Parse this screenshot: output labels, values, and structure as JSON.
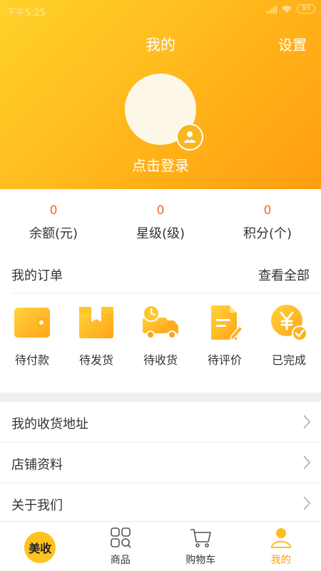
{
  "status_bar": {
    "time": "下午5:25",
    "battery": "93"
  },
  "header": {
    "title": "我的",
    "settings_label": "设置",
    "login_prompt": "点击登录"
  },
  "stats": [
    {
      "value": "0",
      "label": "余额(元)"
    },
    {
      "value": "0",
      "label": "星级(级)"
    },
    {
      "value": "0",
      "label": "积分(个)"
    }
  ],
  "orders": {
    "title": "我的订单",
    "view_all": "查看全部",
    "items": [
      {
        "label": "待付款",
        "icon": "wallet-icon"
      },
      {
        "label": "待发货",
        "icon": "package-box-icon"
      },
      {
        "label": "待收货",
        "icon": "delivery-truck-icon"
      },
      {
        "label": "待评价",
        "icon": "document-edit-icon"
      },
      {
        "label": "已完成",
        "icon": "yen-check-icon"
      }
    ]
  },
  "menu": [
    {
      "label": "我的收货地址"
    },
    {
      "label": "店铺资料"
    },
    {
      "label": "关于我们"
    }
  ],
  "tabbar": {
    "brand": "美收",
    "items": [
      {
        "label": "商品",
        "icon": "grid-search-icon"
      },
      {
        "label": "购物车",
        "icon": "cart-icon"
      },
      {
        "label": "我的",
        "icon": "person-icon",
        "active": true
      }
    ]
  },
  "colors": {
    "accent": "#ffb51a",
    "accent_dark": "#ff9d12",
    "stat_value": "#f26b1d",
    "active_tab": "#f6a315"
  }
}
